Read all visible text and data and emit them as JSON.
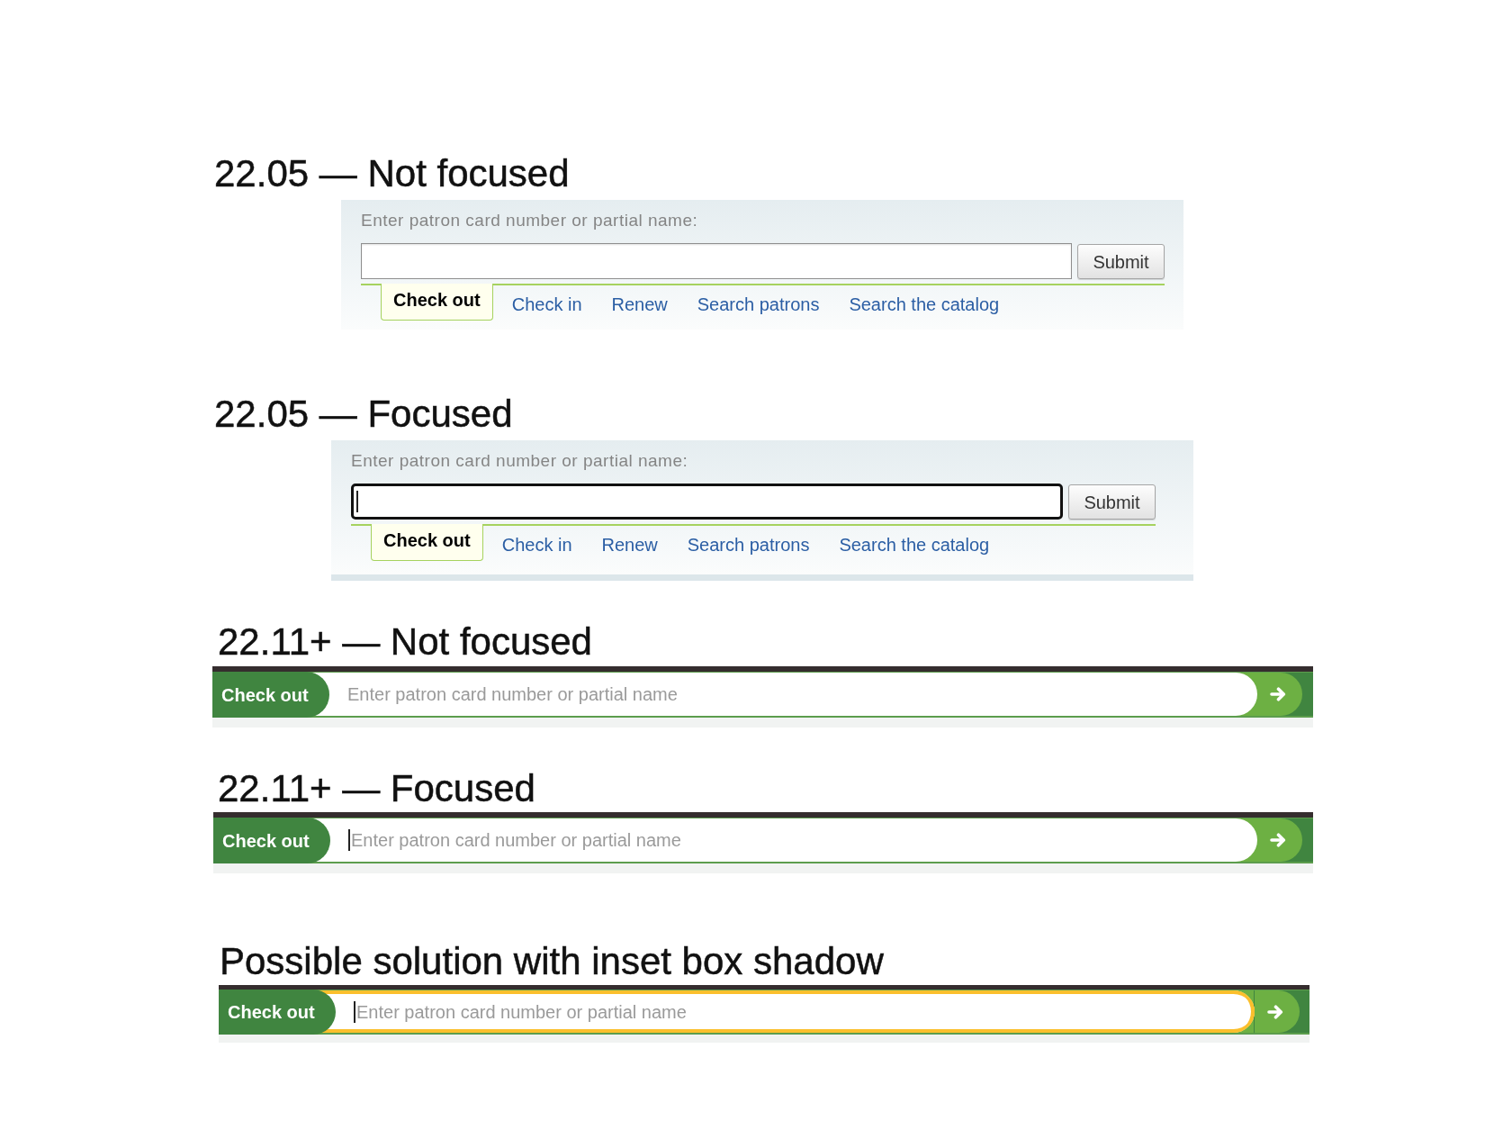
{
  "sections": [
    {
      "kind": "classic",
      "title": "22.05 — Not focused",
      "label": "Enter patron card number or partial name:",
      "field": {
        "focused": false
      },
      "submit": "Submit",
      "tabs": [
        {
          "label": "Check out",
          "selected": true
        },
        {
          "label": "Check in",
          "selected": false
        },
        {
          "label": "Renew",
          "selected": false
        },
        {
          "label": "Search patrons",
          "selected": false
        },
        {
          "label": "Search the catalog",
          "selected": false
        }
      ]
    },
    {
      "kind": "classic",
      "title": "22.05 — Focused",
      "label": "Enter patron card number or partial name:",
      "field": {
        "focused": true
      },
      "submit": "Submit",
      "tabs": [
        {
          "label": "Check out",
          "selected": true
        },
        {
          "label": "Check in",
          "selected": false
        },
        {
          "label": "Renew",
          "selected": false
        },
        {
          "label": "Search patrons",
          "selected": false
        },
        {
          "label": "Search the catalog",
          "selected": false
        }
      ]
    },
    {
      "kind": "modern",
      "title": "22.11+ — Not focused",
      "tab": "Check out",
      "field": {
        "placeholder": "Enter patron card number or partial name",
        "focused": false,
        "inset_shadow": false
      }
    },
    {
      "kind": "modern",
      "title": "22.11+ — Focused",
      "tab": "Check out",
      "field": {
        "placeholder": "Enter patron card number or partial name",
        "focused": true,
        "inset_shadow": false
      }
    },
    {
      "kind": "modern",
      "title": "Possible solution with inset box shadow",
      "tab": "Check out",
      "field": {
        "placeholder": "Enter patron card number or partial name",
        "focused": true,
        "inset_shadow": true
      }
    }
  ]
}
